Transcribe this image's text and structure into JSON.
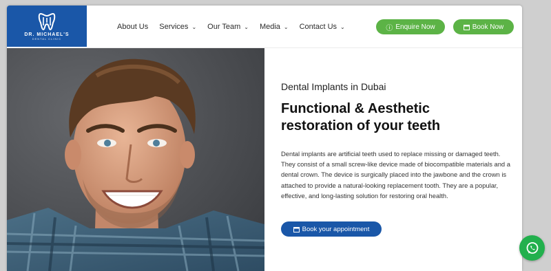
{
  "brand": {
    "name": "DR. MICHAEL'S",
    "subtitle": "DENTAL CLINIC"
  },
  "nav": {
    "items": [
      {
        "label": "About Us",
        "dropdown": false
      },
      {
        "label": "Services",
        "dropdown": true
      },
      {
        "label": "Our Team",
        "dropdown": true
      },
      {
        "label": "Media",
        "dropdown": true
      },
      {
        "label": "Contact Us",
        "dropdown": true
      }
    ]
  },
  "header_buttons": {
    "enquire": {
      "label": "Enquire Now",
      "icon": "question-icon"
    },
    "book": {
      "label": "Book Now",
      "icon": "calendar-icon"
    }
  },
  "hero": {
    "kicker": "Dental Implants in Dubai",
    "headline": "Functional & Aesthetic\nrestoration of your teeth",
    "paragraph": "Dental implants are artificial teeth used to replace missing or damaged teeth. They consist of a small screw-like device made of biocompatible materials and a dental crown. The device is surgically placed into the jawbone and the crown is attached to provide a natural-looking replacement tooth. They are a popular, effective, and long-lasting solution for restoring oral health.",
    "cta": {
      "label": "Book your appointment",
      "icon": "calendar-icon"
    }
  },
  "floating": {
    "icon": "whatsapp-icon"
  },
  "colors": {
    "brand_blue": "#1a57a8",
    "accent_green": "#5cb346",
    "whatsapp_green": "#22b04d"
  }
}
